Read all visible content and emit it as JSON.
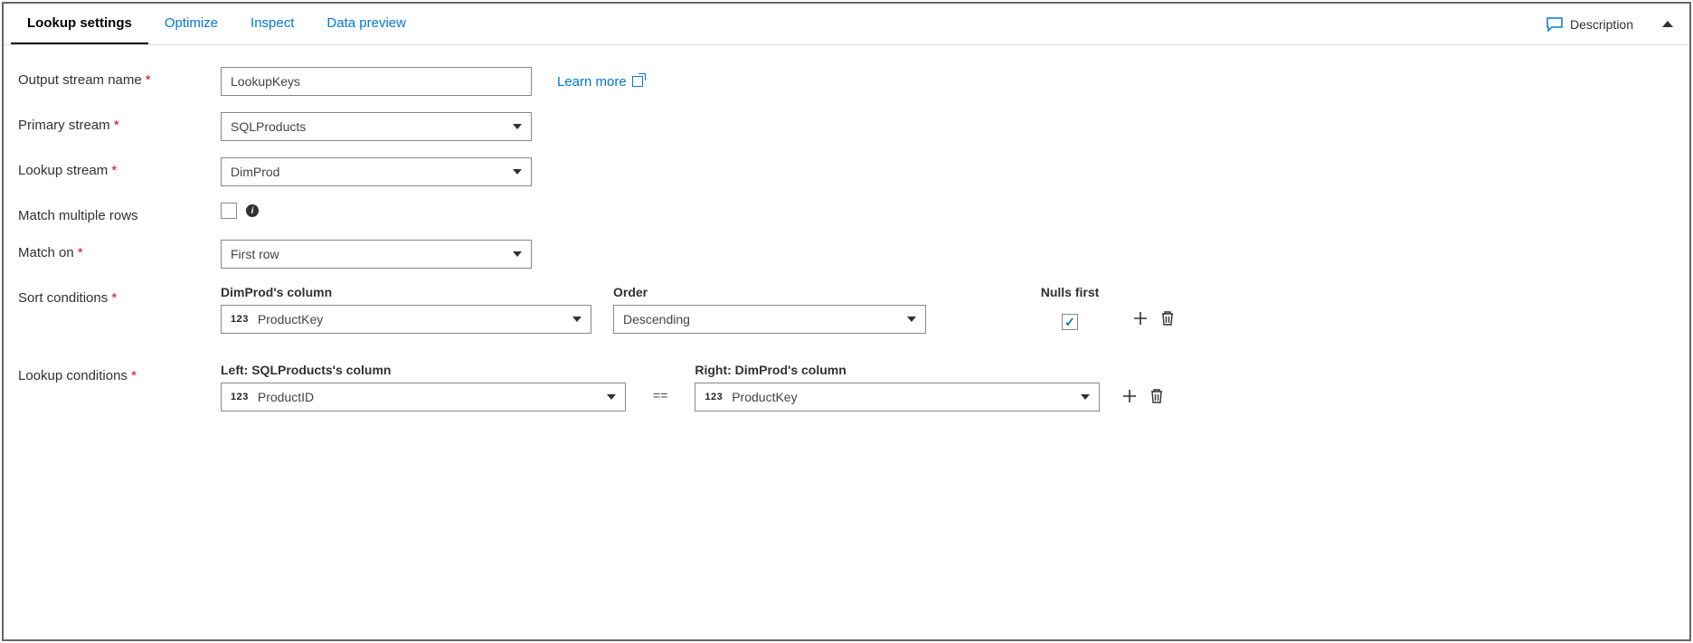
{
  "tabs": {
    "lookup_settings": "Lookup settings",
    "optimize": "Optimize",
    "inspect": "Inspect",
    "data_preview": "Data preview",
    "description": "Description"
  },
  "labels": {
    "output_stream_name": "Output stream name",
    "primary_stream": "Primary stream",
    "lookup_stream": "Lookup stream",
    "match_multiple_rows": "Match multiple rows",
    "match_on": "Match on",
    "sort_conditions": "Sort conditions",
    "lookup_conditions": "Lookup conditions"
  },
  "values": {
    "output_stream_name": "LookupKeys",
    "primary_stream": "SQLProducts",
    "lookup_stream": "DimProd",
    "match_multiple_rows": false,
    "match_on": "First row"
  },
  "link": {
    "learn_more": "Learn more"
  },
  "sort": {
    "column_header": "DimProd's column",
    "order_header": "Order",
    "nulls_header": "Nulls first",
    "row": {
      "type_badge": "123",
      "column": "ProductKey",
      "order": "Descending",
      "nulls_first": true
    }
  },
  "lookup": {
    "left_header": "Left: SQLProducts's column",
    "right_header": "Right: DimProd's column",
    "row": {
      "left_type_badge": "123",
      "left_column": "ProductID",
      "operator": "==",
      "right_type_badge": "123",
      "right_column": "ProductKey"
    }
  }
}
